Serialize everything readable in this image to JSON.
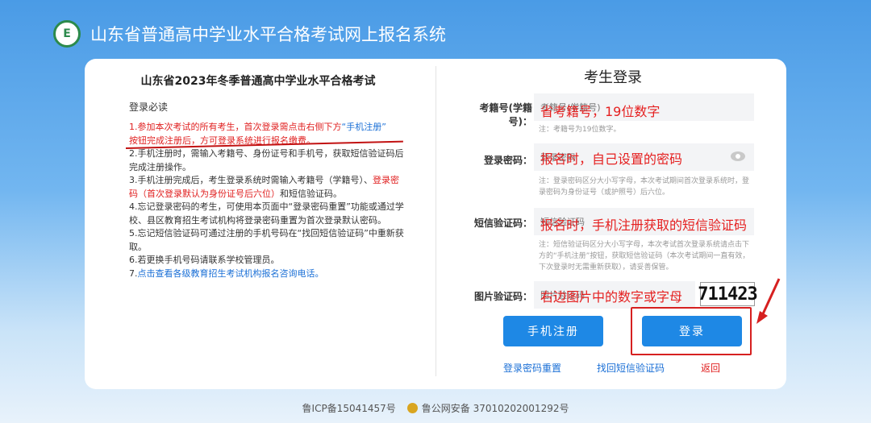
{
  "header": {
    "logo_text": "E",
    "title": "山东省普通高中学业水平合格考试网上报名系统"
  },
  "left": {
    "title": "山东省2023年冬季普通高中学业水平合格考试",
    "must_read": "登录必读",
    "rule1": "1.参加本次考试的所有考生，首次登录需点击右侧下方",
    "rule1_link": "“手机注册”",
    "rule1_b": "按钮完成注册后，方可登录系统进行报名缴费。",
    "rule2": "2.手机注册时，需输入考籍号、身份证号和手机号，获取短信验证码后完成注册操作。",
    "rule3": "3.手机注册完成后，考生登录系统时需输入考籍号（学籍号）、",
    "rule3_red": "登录密码（首次登录默认为身份证号后六位）",
    "rule3_b": "和短信验证码。",
    "rule4": "4.忘记登录密码的考生，可使用本页面中“登录密码重置”功能或通过学校、县区教育招生考试机构将登录密码重置为首次登录默认密码。",
    "rule5": "5.忘记短信验证码可通过注册的手机号码在“找回短信验证码”中重新获取。",
    "rule6": "6.若更换手机号码请联系学校管理员。",
    "rule7_prefix": "7.",
    "rule7_link": "点击查看各级教育招生考试机构报名咨询电话。"
  },
  "login": {
    "title": "考生登录",
    "exam_no_label": "考籍号(学籍号)：",
    "exam_no_placeholder": "考籍号(学籍号)",
    "exam_no_note": "注：考籍号为19位数字。",
    "exam_no_annotation": "省考籍号，19位数字",
    "password_label": "登录密码：",
    "password_placeholder": "登录密码",
    "password_note": "注：登录密码区分大小写字母，本次考试期间首次登录系统时，登录密码为身份证号（或护照号）后六位。",
    "password_annotation": "报名时，自己设置的密码",
    "sms_label": "短信验证码：",
    "sms_placeholder": "短信验证码",
    "sms_note": "注：短信验证码区分大小写字母，本次考试首次登录系统请点击下方的“手机注册”按钮，获取短信验证码（本次考试期间一直有效，下次登录时无需重新获取），请妥善保管。",
    "sms_annotation": "报名时，手机注册获取的短信验证码",
    "captcha_label": "图片验证码：",
    "captcha_placeholder": "图片验证码",
    "captcha_annotation": "右边图片中的数字或字母",
    "captcha_image_text": "711423",
    "register_button": "手机注册",
    "login_button": "登录",
    "reset_password_link": "登录密码重置",
    "recover_sms_link": "找回短信验证码",
    "back_link": "返回"
  },
  "footer": {
    "icp": "鲁ICP备15041457号",
    "police": "鲁公网安备 37010202001292号"
  }
}
